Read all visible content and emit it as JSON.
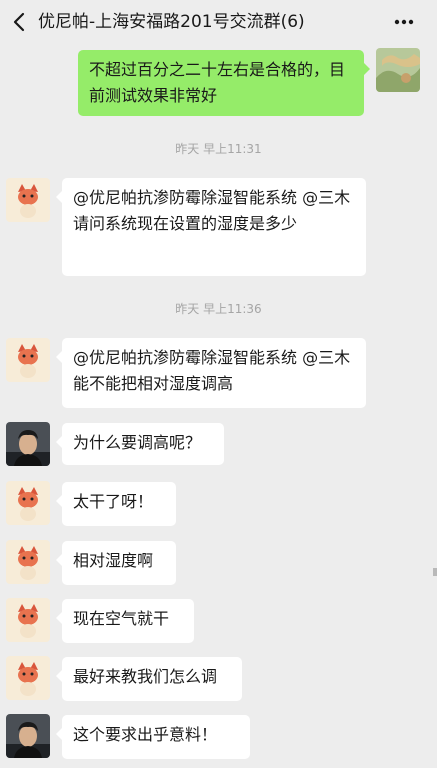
{
  "header": {
    "title": "优尼帕-上海安福路201号交流群(6)"
  },
  "messages": [
    {
      "text": "不超过百分之二十左右是合格的，目前测试效果非常好"
    },
    {
      "text": "@优尼帕抗渗防霉除湿智能系统 @三木  请问系统现在设置的湿度是多少"
    },
    {
      "text": "@优尼帕抗渗防霉除湿智能系统 @三木  能不能把相对湿度调高"
    },
    {
      "text": "为什么要调高呢？"
    },
    {
      "text": "太干了呀！"
    },
    {
      "text": "相对湿度啊"
    },
    {
      "text": "现在空气就干"
    },
    {
      "text": "最好来教我们怎么调"
    },
    {
      "text": "这个要求出乎意料！"
    }
  ],
  "timestamps": [
    "昨天 早上11:31",
    "昨天 早上11:36"
  ],
  "colors": {
    "background": "#ededed",
    "my_bubble": "#95ec69",
    "other_bubble": "#ffffff",
    "timestamp": "#a5a5a5"
  },
  "icons": [
    "back-arrow-icon",
    "more-dots-icon",
    "cartoon-cat-avatar",
    "person-photo-avatar",
    "green-landscape-avatar"
  ]
}
